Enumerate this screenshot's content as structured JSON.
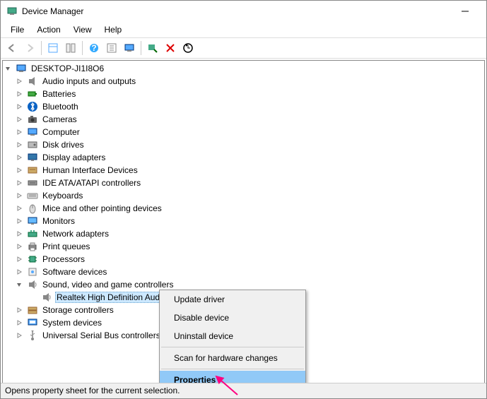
{
  "window": {
    "title": "Device Manager"
  },
  "menu": {
    "items": [
      "File",
      "Action",
      "View",
      "Help"
    ]
  },
  "toolbar": {
    "back": "back-icon",
    "forward": "forward-icon",
    "show_hide": "show-hide-icon",
    "properties": "properties-icon",
    "help": "help-icon",
    "table": "table-icon",
    "computer": "computer-icon",
    "scan": "scan-icon",
    "remove": "remove-icon",
    "up": "up-icon"
  },
  "tree": {
    "root": "DESKTOP-JI1I8O6",
    "categories": [
      {
        "label": "Audio inputs and outputs",
        "icon": "speaker"
      },
      {
        "label": "Batteries",
        "icon": "battery"
      },
      {
        "label": "Bluetooth",
        "icon": "bluetooth"
      },
      {
        "label": "Cameras",
        "icon": "camera"
      },
      {
        "label": "Computer",
        "icon": "computer"
      },
      {
        "label": "Disk drives",
        "icon": "disk"
      },
      {
        "label": "Display adapters",
        "icon": "display"
      },
      {
        "label": "Human Interface Devices",
        "icon": "hid"
      },
      {
        "label": "IDE ATA/ATAPI controllers",
        "icon": "ide"
      },
      {
        "label": "Keyboards",
        "icon": "keyboard"
      },
      {
        "label": "Mice and other pointing devices",
        "icon": "mouse"
      },
      {
        "label": "Monitors",
        "icon": "monitor"
      },
      {
        "label": "Network adapters",
        "icon": "network"
      },
      {
        "label": "Print queues",
        "icon": "printer"
      },
      {
        "label": "Processors",
        "icon": "cpu"
      },
      {
        "label": "Software devices",
        "icon": "software"
      },
      {
        "label": "Sound, video and game controllers",
        "icon": "sound",
        "expanded": true,
        "children": [
          {
            "label": "Realtek High Definition Audio",
            "icon": "sound",
            "selected": true
          }
        ]
      },
      {
        "label": "Storage controllers",
        "icon": "storage"
      },
      {
        "label": "System devices",
        "icon": "system"
      },
      {
        "label": "Universal Serial Bus controllers",
        "icon": "usb"
      }
    ]
  },
  "context_menu": {
    "items": [
      {
        "label": "Update driver"
      },
      {
        "label": "Disable device"
      },
      {
        "label": "Uninstall device"
      },
      {
        "sep": true
      },
      {
        "label": "Scan for hardware changes"
      },
      {
        "sep": true
      },
      {
        "label": "Properties",
        "highlighted": true
      }
    ]
  },
  "statusbar": {
    "text": "Opens property sheet for the current selection."
  }
}
